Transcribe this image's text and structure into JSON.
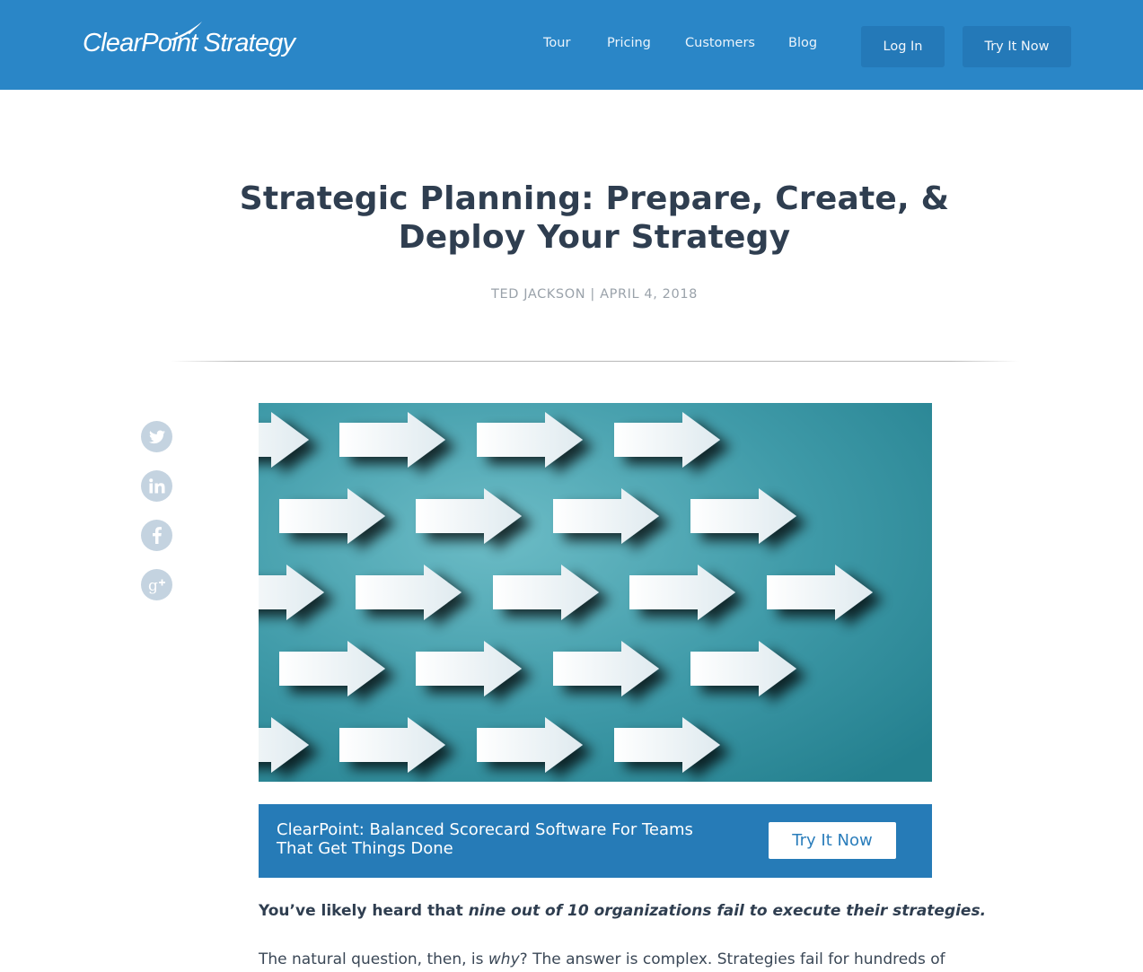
{
  "header": {
    "logo_text": "ClearPoint Strategy",
    "nav": [
      {
        "label": "Tour"
      },
      {
        "label": "Pricing"
      },
      {
        "label": "Customers"
      },
      {
        "label": "Blog"
      }
    ],
    "login_label": "Log In",
    "try_label": "Try It Now",
    "brand_color": "#2a86c7"
  },
  "article": {
    "title": "Strategic Planning: Prepare, Create, & Deploy Your Strategy",
    "author": "TED JACKSON",
    "separator": "|",
    "date": "APRIL 4, 2018",
    "hero_image_alt": "White arrows pointing right on teal background"
  },
  "social": [
    {
      "name": "twitter",
      "icon": "twitter-icon"
    },
    {
      "name": "linkedin",
      "icon": "linkedin-icon"
    },
    {
      "name": "facebook",
      "icon": "facebook-icon"
    },
    {
      "name": "google-plus",
      "icon": "google-plus-icon"
    }
  ],
  "cta": {
    "text": "ClearPoint: Balanced Scorecard Software For Teams That Get Things Done",
    "button_label": "Try It Now"
  },
  "body": {
    "p1_lead": "You’ve likely heard that ",
    "p1_emph": "nine out of 10 organizations fail to execute their strategies.",
    "p2_lead": "The natural question, then, is ",
    "p2_emph": "why",
    "p2_rest": "? The answer is complex. Strategies fail for hundreds of"
  }
}
